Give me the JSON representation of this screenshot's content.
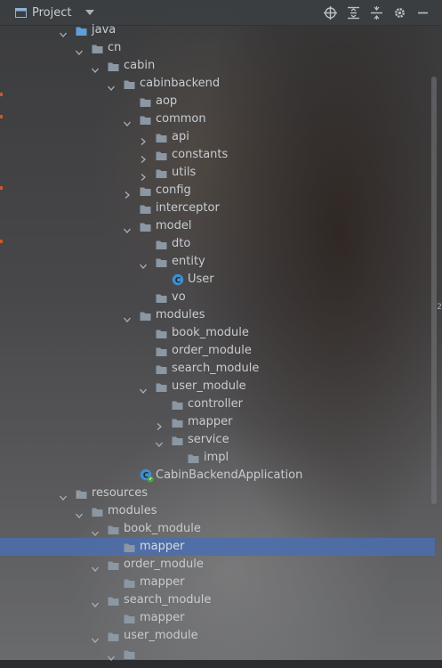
{
  "toolbar": {
    "title": "Project",
    "icons": [
      "locate-icon",
      "expand-all-icon",
      "collapse-all-icon",
      "gear-icon",
      "hide-icon"
    ]
  },
  "tree": [
    {
      "label": "java",
      "depth": 0,
      "expanded": true,
      "icon": "folder-source"
    },
    {
      "label": "cn",
      "depth": 1,
      "expanded": true,
      "icon": "folder"
    },
    {
      "label": "cabin",
      "depth": 2,
      "expanded": true,
      "icon": "folder"
    },
    {
      "label": "cabinbackend",
      "depth": 3,
      "expanded": true,
      "icon": "folder"
    },
    {
      "label": "aop",
      "depth": 4,
      "icon": "folder"
    },
    {
      "label": "common",
      "depth": 4,
      "expanded": true,
      "icon": "folder"
    },
    {
      "label": "api",
      "depth": 5,
      "expanded": false,
      "icon": "folder"
    },
    {
      "label": "constants",
      "depth": 5,
      "expanded": false,
      "icon": "folder"
    },
    {
      "label": "utils",
      "depth": 5,
      "expanded": false,
      "icon": "folder"
    },
    {
      "label": "config",
      "depth": 4,
      "expanded": false,
      "icon": "folder"
    },
    {
      "label": "interceptor",
      "depth": 4,
      "icon": "folder"
    },
    {
      "label": "model",
      "depth": 4,
      "expanded": true,
      "icon": "folder"
    },
    {
      "label": "dto",
      "depth": 5,
      "icon": "folder"
    },
    {
      "label": "entity",
      "depth": 5,
      "expanded": true,
      "icon": "folder"
    },
    {
      "label": "User",
      "depth": 6,
      "icon": "class"
    },
    {
      "label": "vo",
      "depth": 5,
      "icon": "folder"
    },
    {
      "label": "modules",
      "depth": 4,
      "expanded": true,
      "icon": "folder"
    },
    {
      "label": "book_module",
      "depth": 5,
      "icon": "folder"
    },
    {
      "label": "order_module",
      "depth": 5,
      "icon": "folder"
    },
    {
      "label": "search_module",
      "depth": 5,
      "icon": "folder"
    },
    {
      "label": "user_module",
      "depth": 5,
      "expanded": true,
      "icon": "folder"
    },
    {
      "label": "controller",
      "depth": 6,
      "icon": "folder"
    },
    {
      "label": "mapper",
      "depth": 6,
      "expanded": false,
      "icon": "folder"
    },
    {
      "label": "service",
      "depth": 6,
      "expanded": true,
      "icon": "folder"
    },
    {
      "label": "impl",
      "depth": 7,
      "icon": "folder"
    },
    {
      "label": "CabinBackendApplication",
      "depth": 4,
      "icon": "spring-class"
    },
    {
      "label": "resources",
      "depth": 0,
      "expanded": true,
      "icon": "folder-resources"
    },
    {
      "label": "modules",
      "depth": 1,
      "expanded": true,
      "icon": "folder"
    },
    {
      "label": "book_module",
      "depth": 2,
      "expanded": true,
      "icon": "folder"
    },
    {
      "label": "mapper",
      "depth": 3,
      "icon": "folder",
      "selected": true
    },
    {
      "label": "order_module",
      "depth": 2,
      "expanded": true,
      "icon": "folder"
    },
    {
      "label": "mapper",
      "depth": 3,
      "icon": "folder"
    },
    {
      "label": "search_module",
      "depth": 2,
      "expanded": true,
      "icon": "folder"
    },
    {
      "label": "mapper",
      "depth": 3,
      "icon": "folder"
    },
    {
      "label": "user_module",
      "depth": 2,
      "expanded": true,
      "icon": "folder"
    },
    {
      "label": "",
      "depth": 3,
      "expanded": true,
      "icon": "folder"
    }
  ],
  "colors": {
    "selection": "#4b6eaf",
    "folder": "#8b97a2",
    "source_folder": "#5f9fd8",
    "class_icon": "#3d8fd1"
  }
}
